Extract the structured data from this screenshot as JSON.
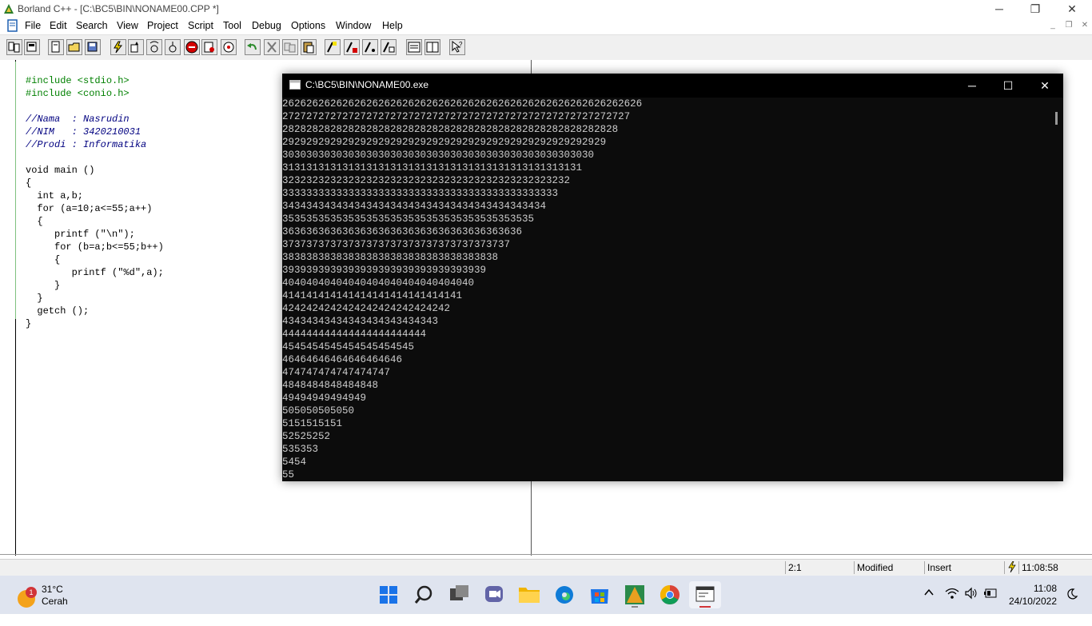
{
  "window": {
    "title": "Borland C++ - [C:\\BC5\\BIN\\NONAME00.CPP *]",
    "minimize": "─",
    "restore": "❐",
    "close": "✕"
  },
  "menu": {
    "items": [
      "File",
      "Edit",
      "Search",
      "View",
      "Project",
      "Script",
      "Tool",
      "Debug",
      "Options",
      "Window",
      "Help"
    ]
  },
  "mdi_controls": {
    "minimize": "_",
    "restore": "❐",
    "close": "✕"
  },
  "code": {
    "lines": [
      "#include <stdio.h>",
      "#include <conio.h>",
      "",
      "//Nama  : Nasrudin",
      "//NIM   : 3420210031",
      "//Prodi : Informatika",
      "",
      "void main ()",
      "{",
      "  int a,b;",
      "  for (a=10;a<=55;a++)",
      "  {",
      "     printf (\"\\n\");",
      "     for (b=a;b<=55;b++)",
      "     {",
      "        printf (\"%d\",a);",
      "     }",
      "  }",
      "  getch ();",
      "}"
    ]
  },
  "console": {
    "title": "C:\\BC5\\BIN\\NONAME00.exe",
    "minimize": "─",
    "maximize": "☐",
    "close": "✕",
    "lines": [
      "262626262626262626262626262626262626262626262626262626262626",
      "2727272727272727272727272727272727272727272727272727272727",
      "28282828282828282828282828282828282828282828282828282828",
      "292929292929292929292929292929292929292929292929292929",
      "3030303030303030303030303030303030303030303030303030",
      "31313131313131313131313131313131313131313131313131",
      "323232323232323232323232323232323232323232323232",
      "3333333333333333333333333333333333333333333333",
      "34343434343434343434343434343434343434343434",
      "353535353535353535353535353535353535353535",
      "3636363636363636363636363636363636363636",
      "37373737373737373737373737373737373737",
      "383838383838383838383838383838383838",
      "3939393939393939393939393939393939",
      "40404040404040404040404040404040",
      "414141414141414141414141414141",
      "4242424242424242424242424242",
      "43434343434343434343434343",
      "444444444444444444444444",
      "4545454545454545454545",
      "46464646464646464646",
      "474747474747474747",
      "4848484848484848",
      "49494949494949",
      "505050505050",
      "5151515151",
      "52525252",
      "535353",
      "5454",
      "55"
    ]
  },
  "status": {
    "position": "2:1",
    "modified": "Modified",
    "mode": "Insert",
    "time": "11:08:58"
  },
  "taskbar": {
    "weather_temp": "31°C",
    "weather_condition": "Cerah",
    "weather_badge": "1",
    "clock_time": "11:08",
    "clock_date": "24/10/2022"
  },
  "colors": {
    "console_bg": "#0c0c0c",
    "console_text": "#cccccc",
    "code_comment": "#000080",
    "code_preprocessor": "#008000",
    "taskbar_bg": "#dfe4ef"
  }
}
